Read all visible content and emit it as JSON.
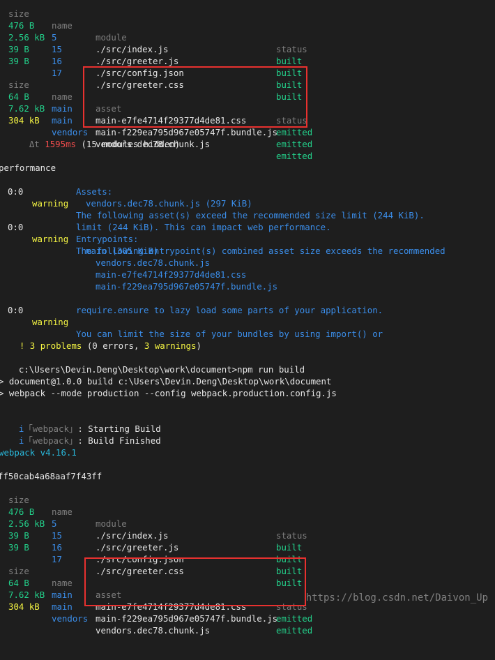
{
  "table1": {
    "header": {
      "size": "size",
      "name": "name",
      "module": "module",
      "status": "status"
    },
    "rows": [
      {
        "size": "476 B",
        "name": "5",
        "module": "./src/index.js",
        "status": "built"
      },
      {
        "size": "2.56 kB",
        "name": "15",
        "module": "./src/greeter.js",
        "status": "built"
      },
      {
        "size": "39 B",
        "name": "16",
        "module": "./src/config.json",
        "status": "built"
      },
      {
        "size": "39 B",
        "name": "17",
        "module": "./src/greeter.css",
        "status": "built"
      }
    ]
  },
  "assets1": {
    "header": {
      "size": "size",
      "name": "name",
      "asset": "asset",
      "status": "status"
    },
    "rows": [
      {
        "size": "64 B",
        "name": "main",
        "asset": "main-e7fe4714f29377d4de81.css",
        "status": "emitted"
      },
      {
        "size": "7.62 kB",
        "name": "main",
        "asset": "main-f229ea795d967e05747f.bundle.js",
        "status": "emitted"
      },
      {
        "size": "304 kB",
        "name": "vendors",
        "asset": "vendors.dec78.chunk.js",
        "status": "emitted"
      }
    ]
  },
  "timing": {
    "prefix": "Δt ",
    "ms": "1595ms",
    "hidden": " (15 modules hidden)"
  },
  "performance": {
    "title": "performance",
    "w1": {
      "pos": "0:0",
      "level": "warning",
      "msg": "The following asset(s) exceed the recommended size limit (244 KiB).",
      "assets_label": "Assets:",
      "asset": "vendors.dec78.chunk.js (297 KiB)"
    },
    "w2": {
      "pos": "0:0",
      "level": "warning",
      "msg1": "The following entrypoint(s) combined asset size exceeds the recommended",
      "msg2": "limit (244 KiB). This can impact web performance.",
      "entry_label": "Entrypoints:",
      "entry": "main (305 KiB)",
      "files": [
        "vendors.dec78.chunk.js",
        "main-e7fe4714f29377d4de81.css",
        "main-f229ea795d967e05747f.bundle.js"
      ]
    },
    "w3": {
      "pos": "0:0",
      "level": "warning",
      "msg1": "You can limit the size of your bundles by using import() or",
      "msg2": "require.ensure to lazy load some parts of your application."
    }
  },
  "problems": {
    "bang": "!",
    "count": " 3 problems",
    "detail": " (0 errors, ",
    "warn": "3 warnings",
    "close": ")"
  },
  "command": {
    "prompt": "c:\\Users\\Devin.Deng\\Desktop\\work\\document>",
    "cmd": "npm run build"
  },
  "npm": {
    "line1": "> document@1.0.0 build c:\\Users\\Devin.Deng\\Desktop\\work\\document",
    "line2": "> webpack --mode production --config webpack.production.config.js"
  },
  "plugin": {
    "i": "i",
    "tag": "「webpack」",
    "msg1": ": Starting Build",
    "msg2": ": Build Finished"
  },
  "version": "webpack v4.16.1",
  "hash": "ff50cab4a68aaf7f43ff",
  "table2": {
    "header": {
      "size": "size",
      "name": "name",
      "module": "module",
      "status": "status"
    },
    "rows": [
      {
        "size": "476 B",
        "name": "5",
        "module": "./src/index.js",
        "status": "built"
      },
      {
        "size": "2.56 kB",
        "name": "15",
        "module": "./src/greeter.js",
        "status": "built"
      },
      {
        "size": "39 B",
        "name": "16",
        "module": "./src/config.json",
        "status": "built"
      },
      {
        "size": "39 B",
        "name": "17",
        "module": "./src/greeter.css",
        "status": "built"
      }
    ]
  },
  "assets2": {
    "header": {
      "size": "size",
      "name": "name",
      "asset": "asset",
      "status": "status"
    },
    "rows": [
      {
        "size": "64 B",
        "name": "main",
        "asset": "main-e7fe4714f29377d4de81.css",
        "status": "emitted"
      },
      {
        "size": "7.62 kB",
        "name": "main",
        "asset": "main-f229ea795d967e05747f.bundle.js",
        "status": "emitted"
      },
      {
        "size": "304 kB",
        "name": "vendors",
        "asset": "vendors.dec78.chunk.js",
        "status": ""
      }
    ]
  },
  "watermark": "https://blog.csdn.net/Daivon_Up"
}
